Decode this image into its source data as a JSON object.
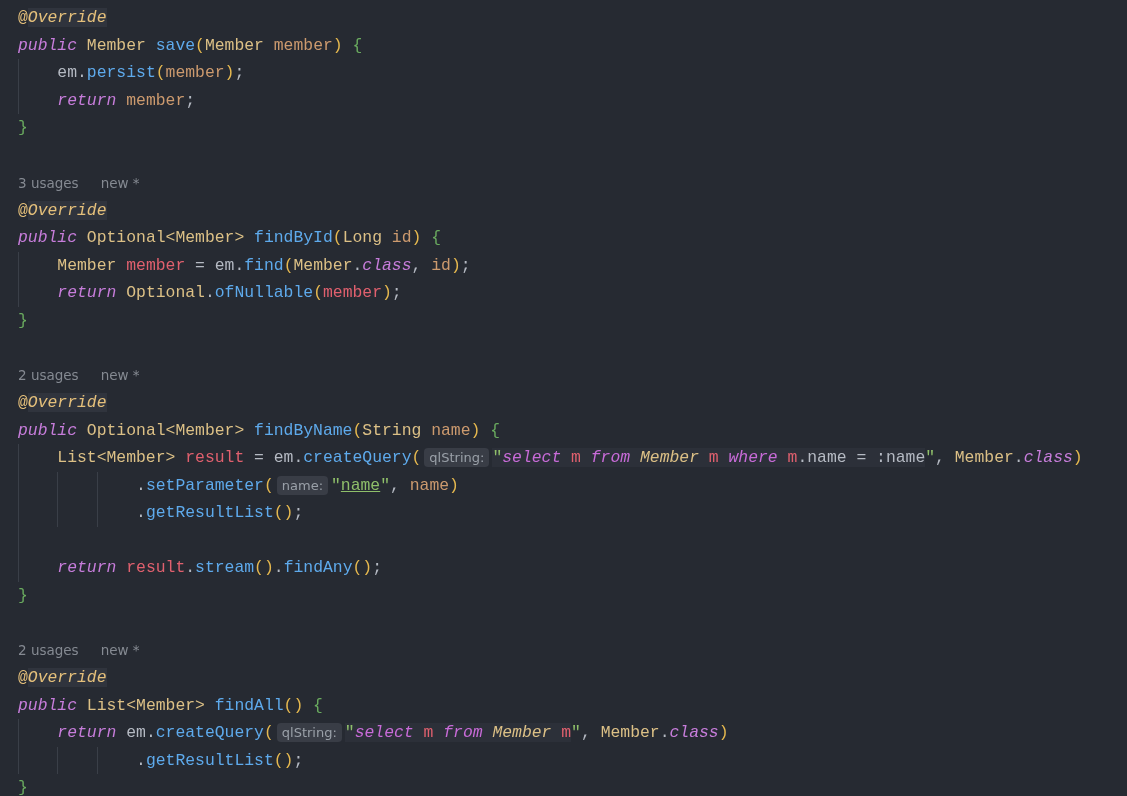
{
  "editor": {
    "lines": [
      {
        "kind": "code",
        "tokens": [
          {
            "t": "@",
            "kind": "ann"
          },
          {
            "t": "Override",
            "kind": "annhl"
          }
        ]
      },
      {
        "kind": "code",
        "tokens": [
          {
            "t": "public ",
            "kind": "kw"
          },
          {
            "t": "Member ",
            "kind": "type"
          },
          {
            "t": "save",
            "kind": "method"
          },
          {
            "t": "(",
            "kind": "paren"
          },
          {
            "t": "Member ",
            "kind": "type"
          },
          {
            "t": "member",
            "kind": "param"
          },
          {
            "t": ") ",
            "kind": "paren"
          },
          {
            "t": "{",
            "kind": "brace"
          }
        ]
      },
      {
        "kind": "code",
        "tokens": [
          {
            "t": "    em.",
            "kind": "plain"
          },
          {
            "t": "persist",
            "kind": "method"
          },
          {
            "t": "(",
            "kind": "paren"
          },
          {
            "t": "member",
            "kind": "param"
          },
          {
            "t": ")",
            "kind": "paren"
          },
          {
            "t": ";",
            "kind": "plain"
          }
        ]
      },
      {
        "kind": "code",
        "tokens": [
          {
            "t": "    return ",
            "kind": "kw"
          },
          {
            "t": "member",
            "kind": "param"
          },
          {
            "t": ";",
            "kind": "plain"
          }
        ]
      },
      {
        "kind": "code",
        "tokens": [
          {
            "t": "}",
            "kind": "brace"
          }
        ]
      },
      {
        "kind": "blank"
      },
      {
        "kind": "hint",
        "texts": [
          "3 usages",
          "new *"
        ]
      },
      {
        "kind": "code",
        "tokens": [
          {
            "t": "@",
            "kind": "ann"
          },
          {
            "t": "Override",
            "kind": "annhl"
          }
        ]
      },
      {
        "kind": "code",
        "tokens": [
          {
            "t": "public ",
            "kind": "kw"
          },
          {
            "t": "Optional<Member> ",
            "kind": "type"
          },
          {
            "t": "findById",
            "kind": "method"
          },
          {
            "t": "(",
            "kind": "paren"
          },
          {
            "t": "Long ",
            "kind": "type"
          },
          {
            "t": "id",
            "kind": "param"
          },
          {
            "t": ") ",
            "kind": "paren"
          },
          {
            "t": "{",
            "kind": "brace"
          }
        ]
      },
      {
        "kind": "code",
        "tokens": [
          {
            "t": "    Member ",
            "kind": "type"
          },
          {
            "t": "member",
            "kind": "local"
          },
          {
            "t": " = em.",
            "kind": "plain"
          },
          {
            "t": "find",
            "kind": "method"
          },
          {
            "t": "(",
            "kind": "paren"
          },
          {
            "t": "Member",
            "kind": "type"
          },
          {
            "t": ".",
            "kind": "plain"
          },
          {
            "t": "class",
            "kind": "kw"
          },
          {
            "t": ", ",
            "kind": "plain"
          },
          {
            "t": "id",
            "kind": "param"
          },
          {
            "t": ")",
            "kind": "paren"
          },
          {
            "t": ";",
            "kind": "plain"
          }
        ]
      },
      {
        "kind": "code",
        "tokens": [
          {
            "t": "    return ",
            "kind": "kw"
          },
          {
            "t": "Optional",
            "kind": "type"
          },
          {
            "t": ".",
            "kind": "plain"
          },
          {
            "t": "ofNullable",
            "kind": "method"
          },
          {
            "t": "(",
            "kind": "paren"
          },
          {
            "t": "member",
            "kind": "local"
          },
          {
            "t": ")",
            "kind": "paren"
          },
          {
            "t": ";",
            "kind": "plain"
          }
        ]
      },
      {
        "kind": "code",
        "tokens": [
          {
            "t": "}",
            "kind": "brace"
          }
        ]
      },
      {
        "kind": "blank"
      },
      {
        "kind": "hint",
        "texts": [
          "2 usages",
          "new *"
        ]
      },
      {
        "kind": "code",
        "tokens": [
          {
            "t": "@",
            "kind": "ann"
          },
          {
            "t": "Override",
            "kind": "annhl"
          }
        ]
      },
      {
        "kind": "code",
        "tokens": [
          {
            "t": "public ",
            "kind": "kw"
          },
          {
            "t": "Optional<Member> ",
            "kind": "type"
          },
          {
            "t": "findByName",
            "kind": "method"
          },
          {
            "t": "(",
            "kind": "paren"
          },
          {
            "t": "String ",
            "kind": "type"
          },
          {
            "t": "name",
            "kind": "param"
          },
          {
            "t": ") ",
            "kind": "paren"
          },
          {
            "t": "{",
            "kind": "brace"
          }
        ]
      },
      {
        "kind": "code",
        "tokens": [
          {
            "t": "    List<Member> ",
            "kind": "type"
          },
          {
            "t": "result",
            "kind": "local"
          },
          {
            "t": " = em.",
            "kind": "plain"
          },
          {
            "t": "createQuery",
            "kind": "method"
          },
          {
            "t": "(",
            "kind": "paren"
          },
          {
            "t": "qlString:",
            "kind": "inlay"
          },
          {
            "t": "\"",
            "kind": "qstr"
          },
          {
            "t": "select ",
            "kind": "qkw"
          },
          {
            "t": "m ",
            "kind": "qalias"
          },
          {
            "t": "from ",
            "kind": "qkw"
          },
          {
            "t": "Member ",
            "kind": "qtype"
          },
          {
            "t": "m ",
            "kind": "qalias"
          },
          {
            "t": "where ",
            "kind": "qkw"
          },
          {
            "t": "m",
            "kind": "qalias"
          },
          {
            "t": ".name = :name",
            "kind": "qplain"
          },
          {
            "t": "\"",
            "kind": "str"
          },
          {
            "t": ", ",
            "kind": "plain"
          },
          {
            "t": "Member",
            "kind": "type"
          },
          {
            "t": ".",
            "kind": "plain"
          },
          {
            "t": "class",
            "kind": "kw"
          },
          {
            "t": ")",
            "kind": "paren"
          }
        ]
      },
      {
        "kind": "code",
        "tokens": [
          {
            "t": "            .",
            "kind": "plain"
          },
          {
            "t": "setParameter",
            "kind": "method"
          },
          {
            "t": "(",
            "kind": "paren"
          },
          {
            "t": "name:",
            "kind": "inlay"
          },
          {
            "t": "\"",
            "kind": "str"
          },
          {
            "t": "name",
            "kind": "strul"
          },
          {
            "t": "\"",
            "kind": "str"
          },
          {
            "t": ", ",
            "kind": "plain"
          },
          {
            "t": "name",
            "kind": "param"
          },
          {
            "t": ")",
            "kind": "paren"
          }
        ]
      },
      {
        "kind": "code",
        "tokens": [
          {
            "t": "            .",
            "kind": "plain"
          },
          {
            "t": "getResultList",
            "kind": "method"
          },
          {
            "t": "()",
            "kind": "paren"
          },
          {
            "t": ";",
            "kind": "plain"
          }
        ]
      },
      {
        "kind": "blank"
      },
      {
        "kind": "code",
        "tokens": [
          {
            "t": "    return ",
            "kind": "kw"
          },
          {
            "t": "result",
            "kind": "local"
          },
          {
            "t": ".",
            "kind": "plain"
          },
          {
            "t": "stream",
            "kind": "method"
          },
          {
            "t": "()",
            "kind": "paren"
          },
          {
            "t": ".",
            "kind": "plain"
          },
          {
            "t": "findAny",
            "kind": "method"
          },
          {
            "t": "()",
            "kind": "paren"
          },
          {
            "t": ";",
            "kind": "plain"
          }
        ]
      },
      {
        "kind": "code",
        "tokens": [
          {
            "t": "}",
            "kind": "brace"
          }
        ]
      },
      {
        "kind": "blank"
      },
      {
        "kind": "hint",
        "texts": [
          "2 usages",
          "new *"
        ]
      },
      {
        "kind": "code",
        "tokens": [
          {
            "t": "@",
            "kind": "ann"
          },
          {
            "t": "Override",
            "kind": "annhl"
          }
        ]
      },
      {
        "kind": "code",
        "tokens": [
          {
            "t": "public ",
            "kind": "kw"
          },
          {
            "t": "List<Member> ",
            "kind": "type"
          },
          {
            "t": "findAll",
            "kind": "method"
          },
          {
            "t": "() ",
            "kind": "paren"
          },
          {
            "t": "{",
            "kind": "brace"
          }
        ]
      },
      {
        "kind": "code",
        "tokens": [
          {
            "t": "    return ",
            "kind": "kw"
          },
          {
            "t": "em.",
            "kind": "plain"
          },
          {
            "t": "createQuery",
            "kind": "method"
          },
          {
            "t": "(",
            "kind": "paren"
          },
          {
            "t": "qlString:",
            "kind": "inlay"
          },
          {
            "t": "\"",
            "kind": "qstr"
          },
          {
            "t": "select ",
            "kind": "qkw"
          },
          {
            "t": "m ",
            "kind": "qalias"
          },
          {
            "t": "from ",
            "kind": "qkw"
          },
          {
            "t": "Member ",
            "kind": "qtype"
          },
          {
            "t": "m",
            "kind": "qalias"
          },
          {
            "t": "\"",
            "kind": "str"
          },
          {
            "t": ", ",
            "kind": "plain"
          },
          {
            "t": "Member",
            "kind": "type"
          },
          {
            "t": ".",
            "kind": "plain"
          },
          {
            "t": "class",
            "kind": "kw"
          },
          {
            "t": ")",
            "kind": "paren"
          }
        ]
      },
      {
        "kind": "code",
        "tokens": [
          {
            "t": "            .",
            "kind": "plain"
          },
          {
            "t": "getResultList",
            "kind": "method"
          },
          {
            "t": "()",
            "kind": "paren"
          },
          {
            "t": ";",
            "kind": "plain"
          }
        ]
      },
      {
        "kind": "code",
        "tokens": [
          {
            "t": "}",
            "kind": "brace"
          }
        ]
      }
    ]
  }
}
